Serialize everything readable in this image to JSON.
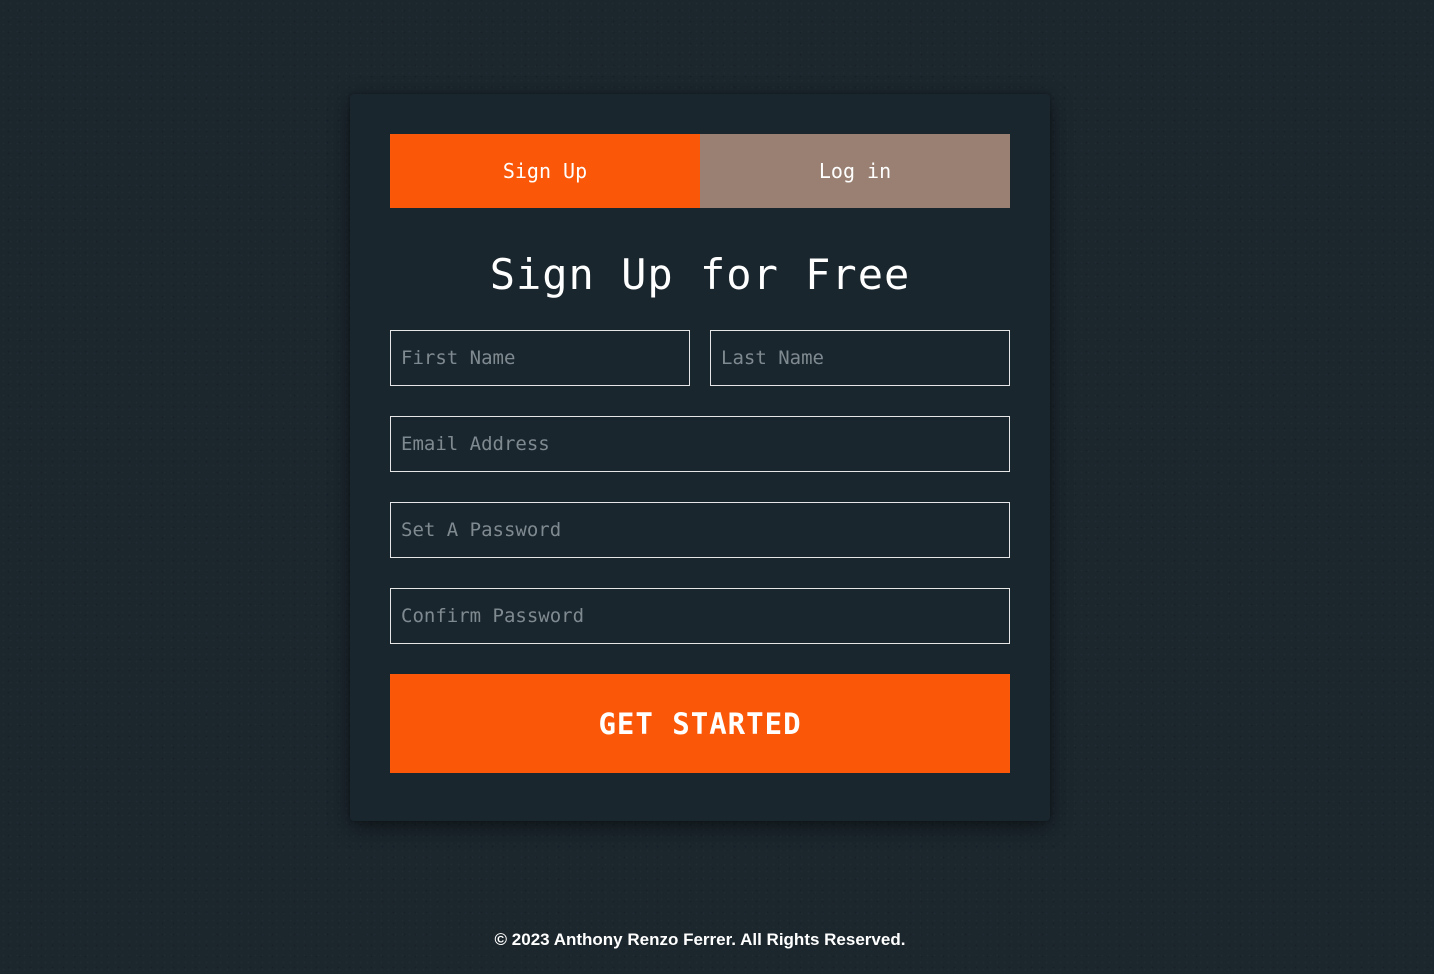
{
  "tabs": {
    "signup_label": "Sign Up",
    "login_label": "Log in"
  },
  "form": {
    "heading": "Sign Up for Free",
    "first_name_placeholder": "First Name",
    "last_name_placeholder": "Last Name",
    "email_placeholder": "Email Address",
    "password_placeholder": "Set A Password",
    "confirm_password_placeholder": "Confirm Password",
    "submit_label": "GET STARTED"
  },
  "footer": {
    "copyright": "© 2023 Anthony Renzo Ferrer. All Rights Reserved."
  },
  "colors": {
    "background": "#1b262d",
    "card": "#1a262e",
    "accent": "#fa5808",
    "inactive_tab": "#998072",
    "input_border": "#e6e6e6"
  }
}
